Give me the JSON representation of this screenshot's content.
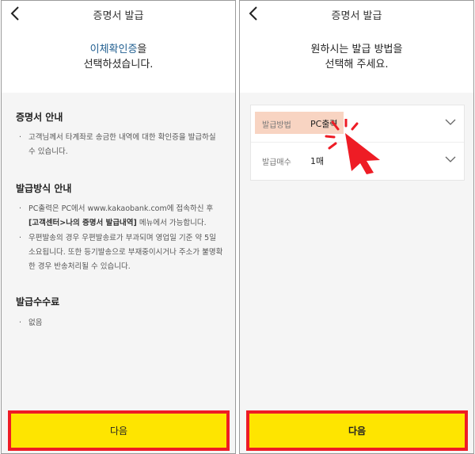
{
  "left": {
    "title": "증명서 발급",
    "heading_accent": "이체확인증",
    "heading_suffix": "을",
    "heading_line2": "선택하셨습니다.",
    "sections": [
      {
        "title": "증명서 안내",
        "bullets": [
          "고객님께서 타계좌로 송금한 내역에 대한 확인증을 발급하실 수 있습니다."
        ]
      },
      {
        "title": "발급방식 안내",
        "bullet1_pre": "PC출력은 PC에서 www.kakaobank.com에 접속하신 후 ",
        "bullet1_bold": "[고객센터>나의 증명서 발급내역]",
        "bullet1_post": " 메뉴에서 가능합니다.",
        "bullet2": "우편발송의 경우 우편발송료가 부과되며 영업일 기준 약 5일 소요됩니다. 또한 등기발송으로 부재중이시거나 주소가 불명확한 경우 반송처리될 수 있습니다."
      },
      {
        "title": "발급수수료",
        "bullets": [
          "없음"
        ]
      }
    ],
    "next_button": "다음"
  },
  "right": {
    "title": "증명서 발급",
    "heading_line1": "원하시는 발급 방법을",
    "heading_line2": "선택해 주세요.",
    "fields": [
      {
        "label": "발급방법",
        "value": "PC출력"
      },
      {
        "label": "발급매수",
        "value": "1매"
      }
    ],
    "next_button": "다음"
  },
  "colors": {
    "accent_text": "#1f5d8f",
    "button_yellow": "#fee500",
    "highlight_border": "#ee1c25",
    "field_highlight": "#f8d4c2",
    "pointer": "#ee1c25"
  },
  "icons": [
    "back-arrow-icon",
    "chevron-down-icon",
    "pointer-cursor-icon"
  ]
}
